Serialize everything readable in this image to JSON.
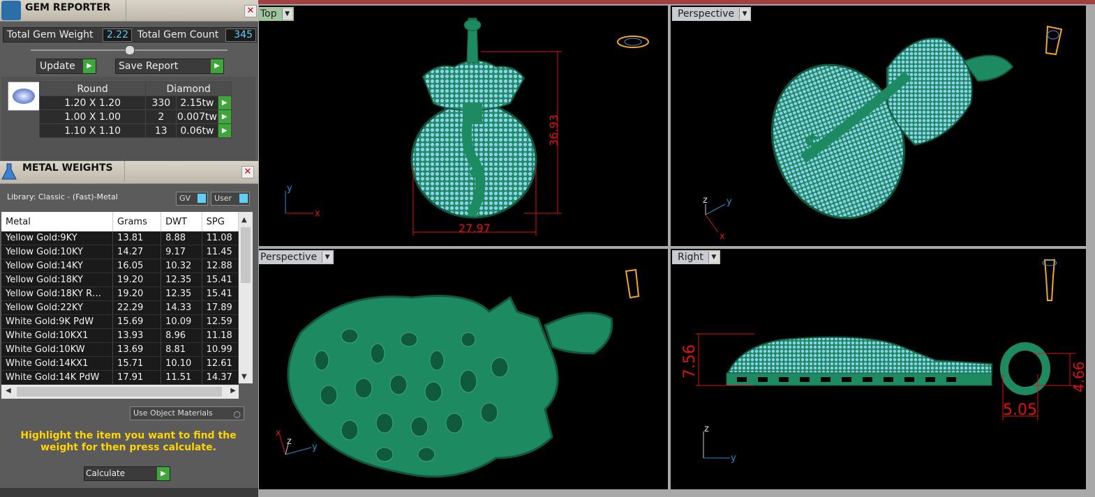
{
  "gem_reporter": {
    "title": "GEM REPORTER",
    "total_weight_label": "Total Gem Weight",
    "total_weight_value": "2.22",
    "total_count_label": "Total Gem Count",
    "total_count_value": "345",
    "update_label": "Update",
    "save_label": "Save Report",
    "table_header": [
      "Round",
      "Diamond"
    ],
    "rows": [
      {
        "size": "1.20 X 1.20",
        "count": "330",
        "weight": "2.15tw"
      },
      {
        "size": "1.00 X 1.00",
        "count": "2",
        "weight": "0.007tw"
      },
      {
        "size": "1.10 X 1.10",
        "count": "13",
        "weight": "0.06tw"
      }
    ]
  },
  "metal_weights": {
    "title": "METAL WEIGHTS",
    "library": "Library: Classic - (Fast)-Metal",
    "gv_label": "GV",
    "user_label": "User",
    "columns": [
      "Metal",
      "Grams",
      "DWT",
      "SPG"
    ],
    "rows": [
      [
        "Yellow Gold:9KY",
        "13.81",
        "8.88",
        "11.08"
      ],
      [
        "Yellow Gold:10KY",
        "14.27",
        "9.17",
        "11.45"
      ],
      [
        "Yellow Gold:14KY",
        "16.05",
        "10.32",
        "12.88"
      ],
      [
        "Yellow Gold:18KY",
        "19.20",
        "12.35",
        "15.41"
      ],
      [
        "Yellow Gold:18KY R…",
        "19.20",
        "12.35",
        "15.41"
      ],
      [
        "Yellow Gold:22KY",
        "22.29",
        "14.33",
        "17.89"
      ],
      [
        "White Gold:9K PdW",
        "15.69",
        "10.09",
        "12.59"
      ],
      [
        "White Gold:10KX1",
        "13.93",
        "8.96",
        "11.18"
      ],
      [
        "White Gold:10KW",
        "13.69",
        "8.81",
        "10.99"
      ],
      [
        "White Gold:14KX1",
        "15.71",
        "10.10",
        "12.61"
      ],
      [
        "White Gold:14K PdW",
        "17.91",
        "11.51",
        "14.37"
      ]
    ],
    "use_object_materials": "Use Object Materials",
    "hint": "Highlight the item you want to find the weight for then press calculate.",
    "calculate_label": "Calculate"
  },
  "viewports": {
    "top": {
      "label": "Top",
      "dim_height": "36.93",
      "dim_width": "27.97"
    },
    "persp1": {
      "label": "Perspective"
    },
    "persp2": {
      "label": "Perspective"
    },
    "right": {
      "label": "Right",
      "dim_height": "7.56",
      "dim_bail": "4.66",
      "dim_bail_w": "5.05"
    }
  },
  "axes": {
    "x": "x",
    "y": "y",
    "z": "z"
  },
  "colors": {
    "model": "#1e8a62",
    "gems": "#8fd0ee",
    "dims": "#e01010",
    "accent": "#5ed0f5",
    "hint": "#ffd400"
  }
}
